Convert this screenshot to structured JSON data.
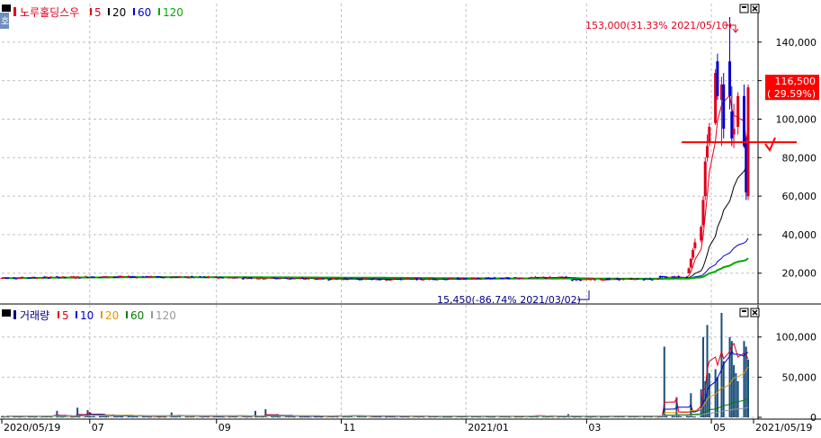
{
  "legend_price": {
    "stock_name": "노루홀딩스우",
    "items": [
      {
        "label": "5",
        "color": "#e0001c"
      },
      {
        "label": "20",
        "color": "#000000"
      },
      {
        "label": "60",
        "color": "#0000cc"
      },
      {
        "label": "120",
        "color": "#00aa00"
      }
    ]
  },
  "legend_volume": {
    "title": "거래량",
    "items": [
      {
        "label": "5",
        "color": "#e0001c"
      },
      {
        "label": "10",
        "color": "#0000cc"
      },
      {
        "label": "20",
        "color": "#e69500"
      },
      {
        "label": "60",
        "color": "#008000"
      },
      {
        "label": "120",
        "color": "#999999"
      }
    ]
  },
  "annotations": {
    "high": "153,000(31.33% 2021/05/10)",
    "low": "15,450(-86.74% 2021/03/02)",
    "current_price": "116,500",
    "current_change": "( 29.59%)"
  },
  "colors": {
    "up": "#e0001c",
    "down": "#0000cc",
    "grid": "#c0c0c0",
    "level_line": "#ff0000"
  },
  "chart_data": [
    {
      "type": "candlestick",
      "title": "노루홀딩스우",
      "x_start": "2020/05/19",
      "x_end": "2021/05/19",
      "x_tick_labels": [
        "2020/05/19",
        "07",
        "09",
        "11",
        "2021/01",
        "03",
        "05",
        "2021/05/19"
      ],
      "y_ticks": [
        20000,
        40000,
        60000,
        80000,
        100000,
        120000,
        140000
      ],
      "y_tick_labels": [
        "20,000",
        "40,000",
        "60,000",
        "80,000",
        "100,000",
        "120,000",
        "140,000"
      ],
      "ylim": [
        4000,
        160000
      ],
      "grid": true,
      "high": {
        "value": 153000,
        "date": "2021/05/10"
      },
      "low": {
        "value": 15450,
        "date": "2021/03/02"
      },
      "last_close": 116500,
      "horizontal_level": 88000,
      "recent_candles": [
        {
          "date": "2021/04/20",
          "open": 20000,
          "high": 23000,
          "low": 20000,
          "close": 22500
        },
        {
          "date": "2021/04/21",
          "open": 23000,
          "high": 28000,
          "low": 22500,
          "close": 27500
        },
        {
          "date": "2021/04/22",
          "open": 28000,
          "high": 33000,
          "low": 27000,
          "close": 32000
        },
        {
          "date": "2021/04/23",
          "open": 33000,
          "high": 38000,
          "low": 32000,
          "close": 36000
        },
        {
          "date": "2021/04/26",
          "open": 37000,
          "high": 45000,
          "low": 36000,
          "close": 44000
        },
        {
          "date": "2021/04/27",
          "open": 45000,
          "high": 60000,
          "low": 44000,
          "close": 58000
        },
        {
          "date": "2021/04/28",
          "open": 60000,
          "high": 80000,
          "low": 58000,
          "close": 78000
        },
        {
          "date": "2021/04/29",
          "open": 80000,
          "high": 92000,
          "low": 78000,
          "close": 86000
        },
        {
          "date": "2021/04/30",
          "open": 88000,
          "high": 98000,
          "low": 86000,
          "close": 96000
        },
        {
          "date": "2021/05/03",
          "open": 98000,
          "high": 126000,
          "low": 97000,
          "close": 124000
        },
        {
          "date": "2021/05/04",
          "open": 130000,
          "high": 134000,
          "low": 110000,
          "close": 112000
        },
        {
          "date": "2021/05/06",
          "open": 110000,
          "high": 122000,
          "low": 86000,
          "close": 118000
        },
        {
          "date": "2021/05/07",
          "open": 118000,
          "high": 124000,
          "low": 90000,
          "close": 95000
        },
        {
          "date": "2021/05/10",
          "open": 130000,
          "high": 153000,
          "low": 105000,
          "close": 112000
        },
        {
          "date": "2021/05/11",
          "open": 104000,
          "high": 117000,
          "low": 86000,
          "close": 90000
        },
        {
          "date": "2021/05/12",
          "open": 92000,
          "high": 108000,
          "low": 85000,
          "close": 95000
        },
        {
          "date": "2021/05/14",
          "open": 96000,
          "high": 114000,
          "low": 92000,
          "close": 112000
        },
        {
          "date": "2021/05/17",
          "open": 112000,
          "high": 118000,
          "low": 85000,
          "close": 86000
        },
        {
          "date": "2021/05/18",
          "open": 88000,
          "high": 90000,
          "low": 58000,
          "close": 62000
        },
        {
          "date": "2021/05/19",
          "open": 60000,
          "high": 118000,
          "low": 58000,
          "close": 116500
        }
      ]
    },
    {
      "type": "bar",
      "title": "거래량",
      "y_ticks": [
        0,
        50000,
        100000
      ],
      "y_tick_labels": [
        "0",
        "50,000",
        "100,000"
      ],
      "ylim": [
        0,
        140000
      ],
      "grid": true,
      "baseline_volume": 1500,
      "notable_volumes": [
        {
          "date": "2020/06/15",
          "value": 8000
        },
        {
          "date": "2020/06/25",
          "value": 12000
        },
        {
          "date": "2020/06/30",
          "value": 9000
        },
        {
          "date": "2020/07/01",
          "value": 6000
        },
        {
          "date": "2020/08/10",
          "value": 6000
        },
        {
          "date": "2020/09/20",
          "value": 8000
        },
        {
          "date": "2020/09/25",
          "value": 10000
        },
        {
          "date": "2021/02/20",
          "value": 4000
        },
        {
          "date": "2021/04/08",
          "value": 88000
        },
        {
          "date": "2021/04/14",
          "value": 25000
        },
        {
          "date": "2021/04/21",
          "value": 30000
        },
        {
          "date": "2021/04/26",
          "value": 35000
        },
        {
          "date": "2021/04/27",
          "value": 100000
        },
        {
          "date": "2021/04/28",
          "value": 45000
        },
        {
          "date": "2021/04/29",
          "value": 115000
        },
        {
          "date": "2021/04/30",
          "value": 55000
        },
        {
          "date": "2021/05/03",
          "value": 60000
        },
        {
          "date": "2021/05/04",
          "value": 50000
        },
        {
          "date": "2021/05/06",
          "value": 130000
        },
        {
          "date": "2021/05/07",
          "value": 70000
        },
        {
          "date": "2021/05/10",
          "value": 100000
        },
        {
          "date": "2021/05/11",
          "value": 95000
        },
        {
          "date": "2021/05/12",
          "value": 65000
        },
        {
          "date": "2021/05/13",
          "value": 55000
        },
        {
          "date": "2021/05/14",
          "value": 45000
        },
        {
          "date": "2021/05/17",
          "value": 95000
        },
        {
          "date": "2021/05/18",
          "value": 88000
        },
        {
          "date": "2021/05/19",
          "value": 72000
        }
      ]
    }
  ]
}
